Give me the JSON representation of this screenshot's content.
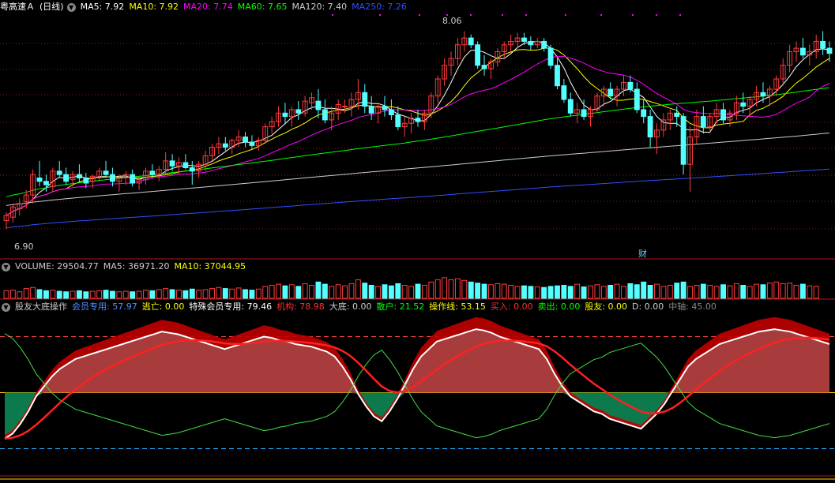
{
  "header": {
    "title": "粤高速Ａ",
    "period": "(日线)",
    "ma": [
      {
        "label": "MA5: 7.92",
        "color": "#ffffff"
      },
      {
        "label": "MA10: 7.92",
        "color": "#ffff00"
      },
      {
        "label": "MA20: 7.74",
        "color": "#ff00ff"
      },
      {
        "label": "MA60: 7.65",
        "color": "#00ff00"
      },
      {
        "label": "MA120: 7.40",
        "color": "#cccccc"
      },
      {
        "label": "MA250: 7.26",
        "color": "#3050ff"
      }
    ]
  },
  "price_labels": {
    "high": "8.06",
    "low": "6.90",
    "event": "财"
  },
  "volume_header": [
    {
      "label": "VOLUME: 29504.77",
      "color": "#cccccc"
    },
    {
      "label": "MA5: 36971.20",
      "color": "#cccccc"
    },
    {
      "label": "MA10: 37044.95",
      "color": "#ffff00"
    }
  ],
  "indicator_header": [
    {
      "label": "股友大底操作",
      "color": "#cccccc"
    },
    {
      "label": "会员专用: 57.97",
      "color": "#5090ff"
    },
    {
      "label": "逃亡: 0.00",
      "color": "#ffff00"
    },
    {
      "label": "特殊会员专用: 79.46",
      "color": "#ffffff"
    },
    {
      "label": "机构: 78.98",
      "color": "#ff3030"
    },
    {
      "label": "大底: 0.00",
      "color": "#cccccc"
    },
    {
      "label": "散户: 21.52",
      "color": "#00ff00"
    },
    {
      "label": "操作线: 53.15",
      "color": "#ffff00"
    },
    {
      "label": "买入: 0.00",
      "color": "#ff3030"
    },
    {
      "label": "卖出: 0.00",
      "color": "#00ff00"
    },
    {
      "label": "股友: 0.00",
      "color": "#ffff00"
    },
    {
      "label": "D: 0.00",
      "color": "#cccccc"
    },
    {
      "label": "中轴: 45.00",
      "color": "#888888"
    }
  ],
  "colors": {
    "up": "#ff3c3c",
    "down": "#54ffff",
    "ma5": "#ffffff",
    "ma10": "#ffff00",
    "ma20": "#ff00ff",
    "ma60": "#00ff00",
    "ma120": "#cccccc",
    "ma250": "#3050ff",
    "grid": "#8b1a1a"
  },
  "chart_data": {
    "type": "candlestick",
    "ylim": [
      6.8,
      8.15
    ],
    "ohlc": [
      [
        6.95,
        7.0,
        6.9,
        6.98
      ],
      [
        6.97,
        7.05,
        6.94,
        7.03
      ],
      [
        7.02,
        7.08,
        6.98,
        7.05
      ],
      [
        7.06,
        7.13,
        7.02,
        7.1
      ],
      [
        7.1,
        7.25,
        7.05,
        7.22
      ],
      [
        7.2,
        7.3,
        7.15,
        7.18
      ],
      [
        7.18,
        7.22,
        7.12,
        7.16
      ],
      [
        7.15,
        7.26,
        7.12,
        7.24
      ],
      [
        7.24,
        7.3,
        7.2,
        7.22
      ],
      [
        7.22,
        7.26,
        7.16,
        7.18
      ],
      [
        7.19,
        7.24,
        7.15,
        7.22
      ],
      [
        7.22,
        7.28,
        7.18,
        7.2
      ],
      [
        7.2,
        7.23,
        7.14,
        7.17
      ],
      [
        7.18,
        7.22,
        7.14,
        7.21
      ],
      [
        7.2,
        7.26,
        7.18,
        7.24
      ],
      [
        7.24,
        7.3,
        7.2,
        7.22
      ],
      [
        7.22,
        7.26,
        7.15,
        7.18
      ],
      [
        7.18,
        7.22,
        7.12,
        7.2
      ],
      [
        7.2,
        7.24,
        7.16,
        7.22
      ],
      [
        7.22,
        7.25,
        7.15,
        7.17
      ],
      [
        7.17,
        7.21,
        7.13,
        7.19
      ],
      [
        7.19,
        7.26,
        7.16,
        7.24
      ],
      [
        7.24,
        7.28,
        7.2,
        7.22
      ],
      [
        7.22,
        7.27,
        7.18,
        7.25
      ],
      [
        7.25,
        7.35,
        7.22,
        7.3
      ],
      [
        7.3,
        7.34,
        7.24,
        7.27
      ],
      [
        7.27,
        7.32,
        7.22,
        7.29
      ],
      [
        7.29,
        7.34,
        7.25,
        7.26
      ],
      [
        7.26,
        7.3,
        7.16,
        7.24
      ],
      [
        7.24,
        7.3,
        7.2,
        7.28
      ],
      [
        7.28,
        7.36,
        7.24,
        7.33
      ],
      [
        7.33,
        7.4,
        7.3,
        7.38
      ],
      [
        7.38,
        7.44,
        7.34,
        7.4
      ],
      [
        7.4,
        7.44,
        7.36,
        7.38
      ],
      [
        7.38,
        7.43,
        7.34,
        7.42
      ],
      [
        7.42,
        7.48,
        7.38,
        7.44
      ],
      [
        7.44,
        7.47,
        7.38,
        7.41
      ],
      [
        7.41,
        7.45,
        7.37,
        7.39
      ],
      [
        7.39,
        7.44,
        7.36,
        7.42
      ],
      [
        7.42,
        7.52,
        7.4,
        7.5
      ],
      [
        7.5,
        7.56,
        7.46,
        7.53
      ],
      [
        7.53,
        7.62,
        7.5,
        7.58
      ],
      [
        7.58,
        7.64,
        7.52,
        7.56
      ],
      [
        7.56,
        7.62,
        7.5,
        7.6
      ],
      [
        7.6,
        7.65,
        7.54,
        7.58
      ],
      [
        7.58,
        7.68,
        7.56,
        7.65
      ],
      [
        7.64,
        7.7,
        7.6,
        7.67
      ],
      [
        7.65,
        7.72,
        7.55,
        7.6
      ],
      [
        7.6,
        7.66,
        7.52,
        7.54
      ],
      [
        7.54,
        7.62,
        7.48,
        7.58
      ],
      [
        7.58,
        7.66,
        7.54,
        7.63
      ],
      [
        7.62,
        7.66,
        7.58,
        7.62
      ],
      [
        7.62,
        7.7,
        7.56,
        7.66
      ],
      [
        7.66,
        7.78,
        7.6,
        7.7
      ],
      [
        7.7,
        7.75,
        7.58,
        7.62
      ],
      [
        7.62,
        7.68,
        7.54,
        7.58
      ],
      [
        7.58,
        7.63,
        7.52,
        7.62
      ],
      [
        7.62,
        7.68,
        7.56,
        7.6
      ],
      [
        7.6,
        7.66,
        7.54,
        7.57
      ],
      [
        7.57,
        7.62,
        7.48,
        7.5
      ],
      [
        7.5,
        7.56,
        7.44,
        7.52
      ],
      [
        7.52,
        7.58,
        7.46,
        7.55
      ],
      [
        7.55,
        7.6,
        7.5,
        7.53
      ],
      [
        7.53,
        7.6,
        7.48,
        7.58
      ],
      [
        7.58,
        7.7,
        7.55,
        7.68
      ],
      [
        7.68,
        7.8,
        7.64,
        7.78
      ],
      [
        7.78,
        7.9,
        7.74,
        7.86
      ],
      [
        7.86,
        7.94,
        7.8,
        7.9
      ],
      [
        7.9,
        8.02,
        7.86,
        7.98
      ],
      [
        7.98,
        8.06,
        7.94,
        8.02
      ],
      [
        8.02,
        8.04,
        7.96,
        7.98
      ],
      [
        7.98,
        8.0,
        7.84,
        7.86
      ],
      [
        7.86,
        7.92,
        7.8,
        7.84
      ],
      [
        7.84,
        7.9,
        7.78,
        7.88
      ],
      [
        7.88,
        7.96,
        7.85,
        7.94
      ],
      [
        7.94,
        8.0,
        7.9,
        7.98
      ],
      [
        7.98,
        8.04,
        7.94,
        8.0
      ],
      [
        8.0,
        8.05,
        7.96,
        8.02
      ],
      [
        8.02,
        8.05,
        7.98,
        8.0
      ],
      [
        8.0,
        8.03,
        7.95,
        7.98
      ],
      [
        7.98,
        8.02,
        7.96,
        8.0
      ],
      [
        8.0,
        8.02,
        7.94,
        7.96
      ],
      [
        7.96,
        7.98,
        7.84,
        7.86
      ],
      [
        7.86,
        7.9,
        7.72,
        7.74
      ],
      [
        7.74,
        7.78,
        7.64,
        7.66
      ],
      [
        7.66,
        7.7,
        7.56,
        7.58
      ],
      [
        7.58,
        7.64,
        7.52,
        7.6
      ],
      [
        7.6,
        7.66,
        7.54,
        7.56
      ],
      [
        7.56,
        7.62,
        7.5,
        7.6
      ],
      [
        7.6,
        7.7,
        7.58,
        7.68
      ],
      [
        7.68,
        7.74,
        7.62,
        7.72
      ],
      [
        7.72,
        7.76,
        7.66,
        7.68
      ],
      [
        7.68,
        7.74,
        7.62,
        7.72
      ],
      [
        7.72,
        7.8,
        7.68,
        7.76
      ],
      [
        7.76,
        7.8,
        7.7,
        7.72
      ],
      [
        7.72,
        7.76,
        7.58,
        7.6
      ],
      [
        7.6,
        7.66,
        7.52,
        7.56
      ],
      [
        7.56,
        7.6,
        7.38,
        7.44
      ],
      [
        7.44,
        7.52,
        7.34,
        7.48
      ],
      [
        7.48,
        7.58,
        7.44,
        7.54
      ],
      [
        7.54,
        7.6,
        7.48,
        7.58
      ],
      [
        7.58,
        7.62,
        7.5,
        7.56
      ],
      [
        7.56,
        7.58,
        7.22,
        7.28
      ],
      [
        7.28,
        7.5,
        7.12,
        7.44
      ],
      [
        7.44,
        7.6,
        7.4,
        7.56
      ],
      [
        7.56,
        7.62,
        7.46,
        7.5
      ],
      [
        7.5,
        7.58,
        7.46,
        7.56
      ],
      [
        7.56,
        7.64,
        7.52,
        7.6
      ],
      [
        7.6,
        7.64,
        7.52,
        7.54
      ],
      [
        7.54,
        7.6,
        7.5,
        7.58
      ],
      [
        7.58,
        7.68,
        7.54,
        7.64
      ],
      [
        7.64,
        7.7,
        7.58,
        7.62
      ],
      [
        7.62,
        7.68,
        7.56,
        7.66
      ],
      [
        7.66,
        7.74,
        7.62,
        7.7
      ],
      [
        7.7,
        7.76,
        7.64,
        7.68
      ],
      [
        7.68,
        7.74,
        7.62,
        7.72
      ],
      [
        7.72,
        7.8,
        7.68,
        7.78
      ],
      [
        7.78,
        7.9,
        7.74,
        7.86
      ],
      [
        7.86,
        7.98,
        7.82,
        7.94
      ],
      [
        7.94,
        8.0,
        7.88,
        7.96
      ],
      [
        7.96,
        8.02,
        7.9,
        7.92
      ],
      [
        7.92,
        7.98,
        7.86,
        7.94
      ],
      [
        7.94,
        8.04,
        7.9,
        8.0
      ],
      [
        8.0,
        8.06,
        7.92,
        7.96
      ],
      [
        7.96,
        8.0,
        7.88,
        7.93
      ]
    ],
    "volume": [
      14,
      15,
      12,
      18,
      20,
      16,
      14,
      15,
      13,
      12,
      13,
      14,
      12,
      13,
      14,
      15,
      13,
      12,
      13,
      12,
      13,
      15,
      14,
      16,
      18,
      16,
      15,
      14,
      17,
      15,
      16,
      18,
      20,
      18,
      17,
      19,
      16,
      15,
      17,
      22,
      24,
      26,
      23,
      25,
      22,
      27,
      24,
      30,
      26,
      22,
      25,
      23,
      27,
      34,
      28,
      24,
      22,
      25,
      23,
      27,
      24,
      22,
      26,
      24,
      30,
      34,
      38,
      34,
      36,
      33,
      30,
      28,
      26,
      25,
      27,
      26,
      24,
      22,
      23,
      22,
      21,
      20,
      22,
      23,
      24,
      22,
      26,
      21,
      23,
      25,
      22,
      24,
      26,
      22,
      27,
      25,
      30,
      24,
      26,
      22,
      24,
      28,
      30,
      22,
      24,
      26,
      24,
      22,
      25,
      23,
      27,
      24,
      22,
      26,
      25,
      28,
      30,
      27,
      28,
      24,
      26,
      23,
      22
    ],
    "volume_max": 45,
    "indicator": {
      "ylim": [
        -20,
        110
      ],
      "midline": 45,
      "upper_line": 90,
      "lower_line": 0,
      "white_line": [
        8,
        12,
        20,
        30,
        42,
        50,
        58,
        64,
        68,
        72,
        74,
        76,
        78,
        80,
        82,
        84,
        86,
        88,
        90,
        92,
        94,
        93,
        92,
        90,
        88,
        86,
        84,
        82,
        80,
        82,
        84,
        86,
        88,
        90,
        89,
        87,
        86,
        84,
        83,
        82,
        80,
        78,
        74,
        66,
        56,
        44,
        34,
        26,
        22,
        30,
        40,
        52,
        64,
        74,
        80,
        86,
        88,
        90,
        92,
        94,
        96,
        95,
        93,
        90,
        88,
        86,
        84,
        82,
        80,
        72,
        60,
        50,
        42,
        38,
        34,
        30,
        28,
        24,
        22,
        20,
        18,
        16,
        22,
        28,
        36,
        46,
        56,
        66,
        72,
        76,
        80,
        84,
        86,
        88,
        90,
        92,
        94,
        95,
        96,
        95,
        94,
        92,
        90,
        88,
        86,
        84
      ]
    }
  }
}
